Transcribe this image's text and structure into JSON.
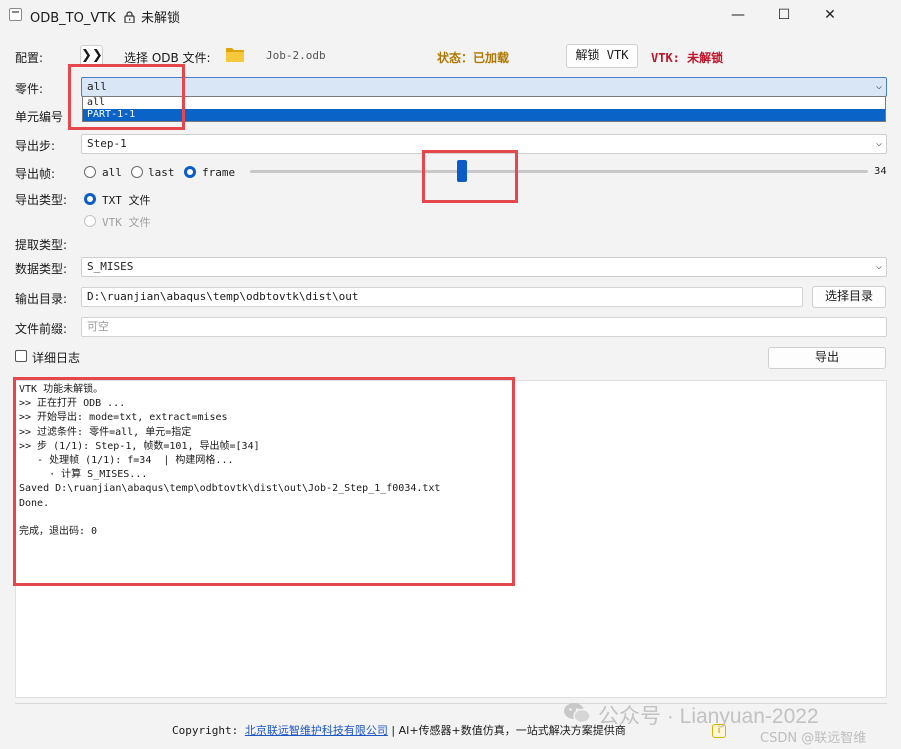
{
  "window": {
    "title": "ODB_TO_VTK",
    "lock_icon": "lock-icon",
    "title_status": "未解锁",
    "min_glyph": "—",
    "max_glyph": "☐",
    "close_glyph": "✕"
  },
  "config": {
    "label": "配置:",
    "toggle_label": "❯❯",
    "select_odb_label": "选择 ODB 文件:",
    "odb_file": "Job-2.odb",
    "status": "状态：已加载",
    "unlock_button": "解锁 VTK",
    "vtk_status": "VTK: 未解锁"
  },
  "part": {
    "label": "零件:",
    "selected": "all",
    "options": [
      "all",
      "PART-1-1"
    ],
    "highlighted_option": "PART-1-1"
  },
  "element_number": {
    "label": "单元编号"
  },
  "export_step": {
    "label": "导出步:",
    "selected": "Step-1"
  },
  "export_frame": {
    "label": "导出帧:",
    "options": [
      "all",
      "last",
      "frame"
    ],
    "selected": "frame",
    "slider_value": "34",
    "slider_fraction": 0.34
  },
  "export_type": {
    "label": "导出类型:",
    "options": [
      "TXT 文件",
      "VTK 文件"
    ],
    "selected": "TXT 文件"
  },
  "extract_type": {
    "label": "提取类型:"
  },
  "data_type": {
    "label": "数据类型:",
    "selected": "S_MISES"
  },
  "output_dir": {
    "label": "输出目录:",
    "value": "D:\\ruanjian\\abaqus\\temp\\odbtovtk\\dist\\out",
    "choose_button": "选择目录"
  },
  "file_prefix": {
    "label": "文件前缀:",
    "placeholder": "可空"
  },
  "verbose": {
    "label": "详细日志",
    "checked": false
  },
  "export_button": "导出",
  "log": {
    "text": "VTK 功能未解锁。\n>> 正在打开 ODB ...\n>> 开始导出: mode=txt, extract=mises\n>> 过滤条件: 零件=all, 单元=指定\n>> 步 (1/1): Step-1, 帧数=101, 导出帧=[34]\n   - 处理帧 (1/1): f=34  | 构建网格...\n     · 计算 S_MISES...\nSaved D:\\ruanjian\\abaqus\\temp\\odbtovtk\\dist\\out\\Job-2_Step_1_f0034.txt\nDone.\n\n完成，退出码: 0"
  },
  "footer": {
    "prefix": "Copyright: ",
    "company": "北京联远智维护科技有限公司",
    "separator": " | ",
    "slogan": "AI+传感器+数值仿真，一站式解决方案提供商"
  },
  "watermark": {
    "main": "公众号 · Lianyuan-2022",
    "csdn": "CSDN @联远智维"
  },
  "colors": {
    "accent": "#0b5cc7",
    "status_loaded": "#b07800",
    "vtk_locked": "#c0142a",
    "annotation_red": "#e5474c",
    "link": "#1c55c4"
  }
}
